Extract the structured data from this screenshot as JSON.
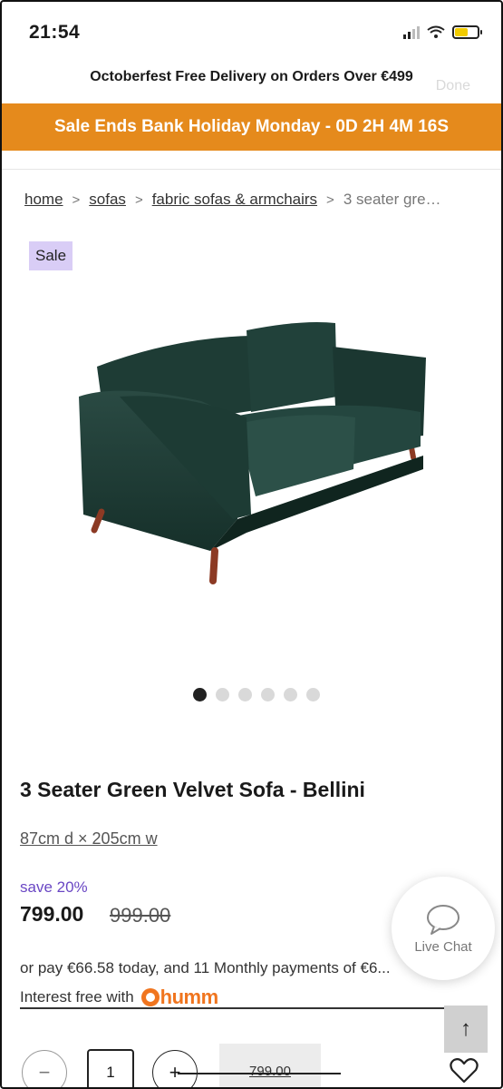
{
  "status_bar": {
    "time": "21:54"
  },
  "header": {
    "promo": "Octoberfest Free Delivery on Orders Over €499",
    "done_ghost": "Done",
    "sale_banner": "Sale Ends Bank Holiday Monday - 0D 2H 4M 16S"
  },
  "breadcrumb": {
    "items": [
      "home",
      "sofas",
      "fabric sofas & armchairs"
    ],
    "current": "3 seater gre…",
    "separator": ">"
  },
  "badge": "Sale",
  "gallery": {
    "dot_count": 6,
    "active_index": 0
  },
  "product": {
    "title": "3 Seater Green Velvet Sofa - Bellini",
    "dimensions": "87cm d × 205cm w",
    "save": "save 20%",
    "price": "799.00",
    "old_price": "999.00",
    "pay_line": "or pay €66.58 today, and 11 Monthly payments of €6...",
    "interest_label": "Interest free with",
    "humm": "humm"
  },
  "live_chat": {
    "label": "Live Chat"
  },
  "cart": {
    "minus": "−",
    "quantity": "1",
    "plus": "+",
    "add_label": "799.00"
  },
  "scroll_top": "↑",
  "colors": {
    "banner": "#e58a1c",
    "badge": "#d9cdf6",
    "save": "#6a47c4",
    "humm": "#f0751f",
    "sofa": "#1f3f38"
  }
}
